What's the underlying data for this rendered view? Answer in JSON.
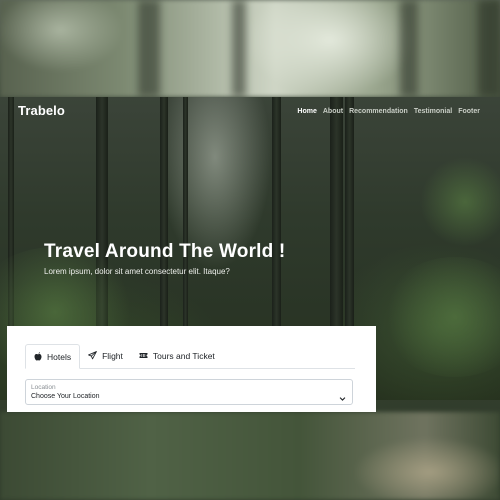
{
  "navbar": {
    "brand": "Trabelo",
    "links": [
      {
        "label": "Home",
        "active": true
      },
      {
        "label": "About",
        "active": false
      },
      {
        "label": "Recommendation",
        "active": false
      },
      {
        "label": "Testimonial",
        "active": false
      },
      {
        "label": "Footer",
        "active": false
      }
    ]
  },
  "hero": {
    "title": "Travel Around The World !",
    "subtitle": "Lorem ipsum, dolor sit amet consectetur elit. Itaque?"
  },
  "search": {
    "tabs": [
      {
        "label": "Hotels",
        "icon": "apple-icon",
        "active": true
      },
      {
        "label": "Flight",
        "icon": "paper-plane-icon",
        "active": false
      },
      {
        "label": "Tours and Ticket",
        "icon": "ticket-icon",
        "active": false
      }
    ],
    "location": {
      "label": "Location",
      "value": "Choose Your Location"
    }
  },
  "colors": {
    "text_dark": "#212529",
    "border": "#dee2e6",
    "hero_text": "#ffffff"
  }
}
